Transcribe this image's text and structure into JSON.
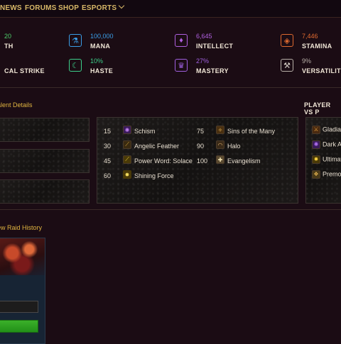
{
  "nav": {
    "items": [
      "NEWS",
      "FORUMS",
      "SHOP",
      "ESPORTS"
    ]
  },
  "stats": [
    {
      "value": "20",
      "label": "TH",
      "icon": "strength-icon",
      "color": "#4fcf6a"
    },
    {
      "value": "100,000",
      "label": "MANA",
      "icon": "mana-potion-icon",
      "color": "#3a9ee8"
    },
    {
      "value": "6,645",
      "label": "INTELLECT",
      "icon": "intellect-icon",
      "color": "#b060e0"
    },
    {
      "value": "7,446",
      "label": "STAMINA",
      "icon": "stamina-icon",
      "color": "#e06a30"
    },
    {
      "value": "",
      "label": "CAL STRIKE",
      "icon": "critical-strike-icon",
      "color": "#e04040"
    },
    {
      "value": "10%",
      "label": "HASTE",
      "icon": "haste-icon",
      "color": "#3ccf8a"
    },
    {
      "value": "27%",
      "label": "MASTERY",
      "icon": "mastery-icon",
      "color": "#a060e0"
    },
    {
      "value": "9%",
      "label": "VERSATILITY",
      "icon": "versatility-icon",
      "color": "#b8b0a8"
    }
  ],
  "sections": {
    "talent_details": "alent Details",
    "pvp_title": "PLAYER VS P",
    "raid_history": "ew Raid History"
  },
  "talents": [
    {
      "level": "15",
      "name": "Schism",
      "icon": "schism-icon",
      "color": "#9a50d0"
    },
    {
      "level": "30",
      "name": "Angelic Feather",
      "icon": "feather-icon",
      "color": "#d0a030"
    },
    {
      "level": "45",
      "name": "Power Word: Solace",
      "icon": "solace-icon",
      "color": "#e8c040"
    },
    {
      "level": "60",
      "name": "Shining Force",
      "icon": "shining-force-icon",
      "color": "#f0d040"
    },
    {
      "level": "75",
      "name": "Sins of the Many",
      "icon": "sins-icon",
      "color": "#e0b050"
    },
    {
      "level": "90",
      "name": "Halo",
      "icon": "halo-icon",
      "color": "#d0a060"
    },
    {
      "level": "100",
      "name": "Evangelism",
      "icon": "evangelism-icon",
      "color": "#e0d0a0"
    }
  ],
  "pvp": [
    {
      "name": "Gladiat",
      "icon": "gladiator-icon",
      "color": "#d09040"
    },
    {
      "name": "Dark A",
      "icon": "dark-archangel-icon",
      "color": "#9050d0"
    },
    {
      "name": "Ultimat",
      "icon": "ultimate-icon",
      "color": "#f0c040"
    },
    {
      "name": "Premo",
      "icon": "premonition-icon",
      "color": "#d0a040"
    }
  ]
}
